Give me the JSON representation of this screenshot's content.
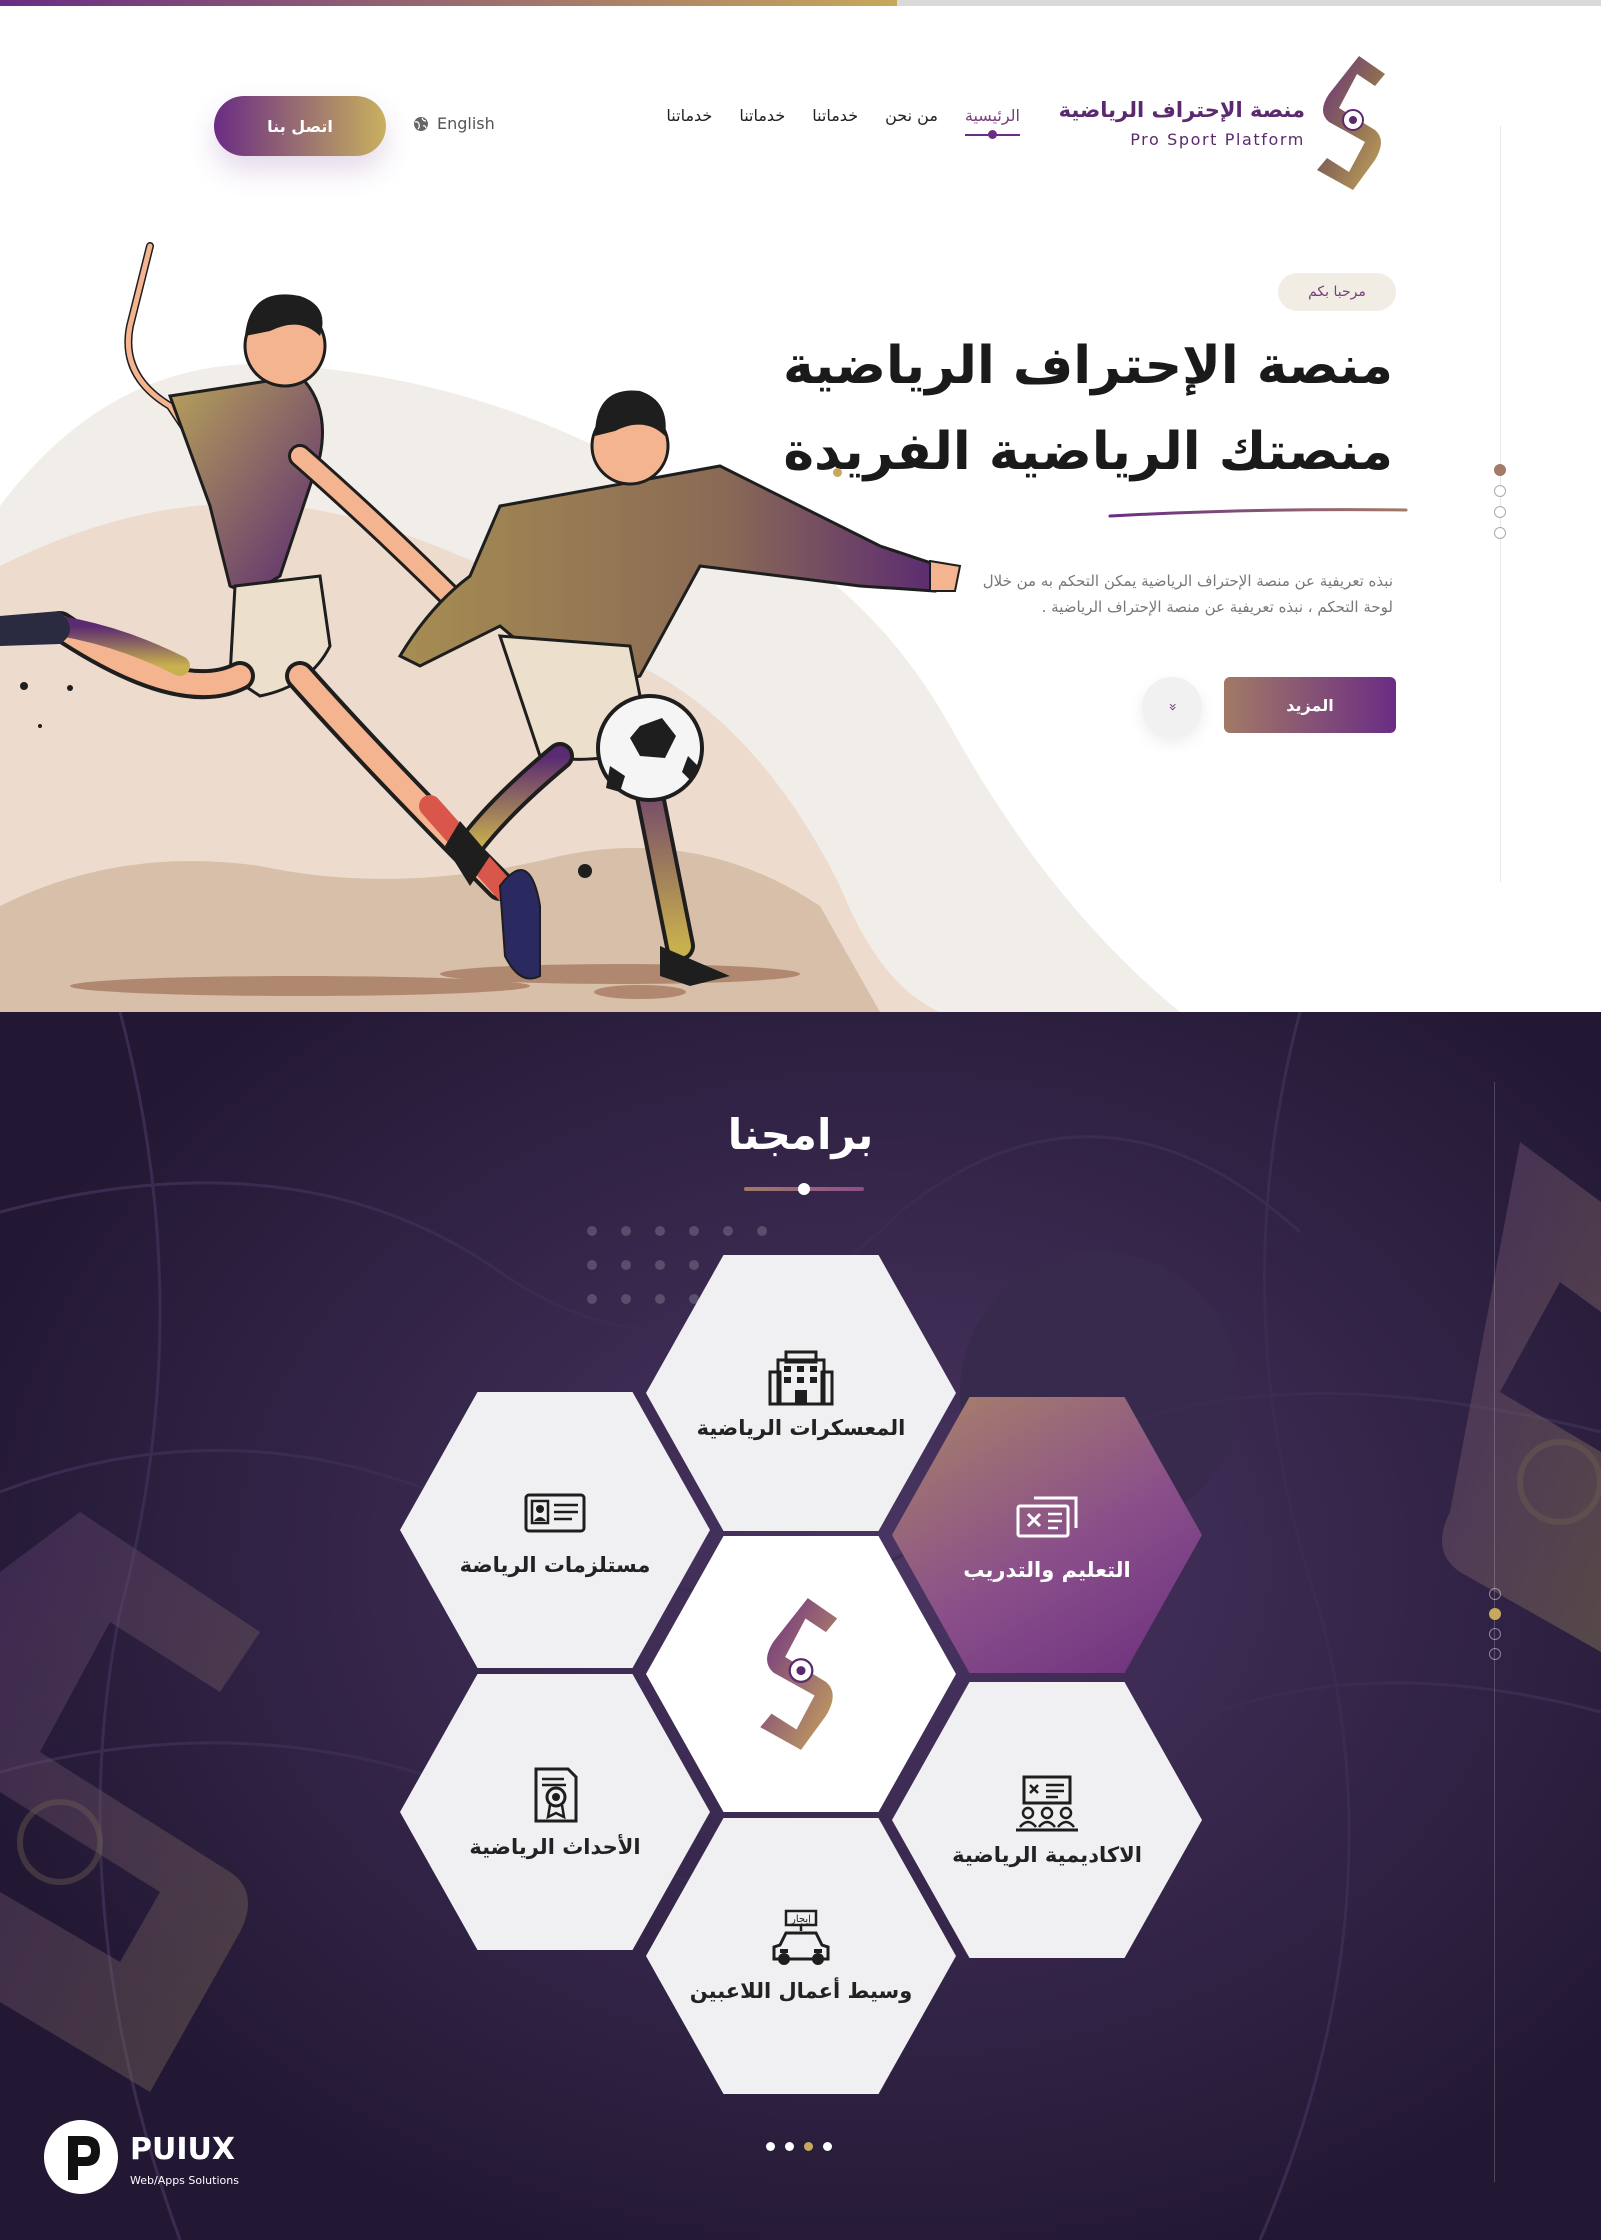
{
  "top_progress": 0.56,
  "logo": {
    "name_ar": "منصة الإحتراف الرياضية",
    "name_en": "Pro Sport Platform"
  },
  "nav": {
    "items": [
      "الرئيسية",
      "من نحن",
      "خدماتنا",
      "خدماتنا",
      "خدماتنا"
    ],
    "active_index": 0
  },
  "header": {
    "language": "English",
    "contact": "اتصل بنا"
  },
  "hero": {
    "welcome": "مرحبا بكم",
    "title_line1": "منصة الإحتراف الرياضية",
    "title_line2": "منصتك الرياضية الفريدة",
    "description": "نبذه تعريفية عن منصة الإحتراف الرياضية يمكن التحكم به من خلال لوحة التحكم ، نبذه تعريفية عن منصة الإحتراف الرياضية .",
    "more_button": "المزيد",
    "scroll_glyph": "»",
    "slider_count": 4,
    "slider_active": 0
  },
  "programs": {
    "title": "برامجنا",
    "items": [
      {
        "label": "المعسكرات الرياضية",
        "icon": "building-icon"
      },
      {
        "label": "مستلزمات الرياضة",
        "icon": "id-card-icon"
      },
      {
        "label": "التعليم والتدريب",
        "icon": "ticket-icon"
      },
      {
        "label": "الأحداث الرياضية",
        "icon": "certificate-icon"
      },
      {
        "label": "الاكاديمية الرياضية",
        "icon": "classroom-icon"
      },
      {
        "label": "وسيط أعمال اللاعبين",
        "icon": "car-rental-icon"
      }
    ],
    "rental_sign": "إيجار",
    "featured_index": 2,
    "side_dots": 4,
    "side_active": 1,
    "pager_count": 4,
    "pager_active": 2
  },
  "footer_brand": {
    "name": "PUIUX",
    "tagline": "Web/Apps Solutions"
  },
  "colors": {
    "purple": "#6a2c84",
    "gold": "#c8a85a",
    "dark_bg": "#2a1c3c"
  }
}
